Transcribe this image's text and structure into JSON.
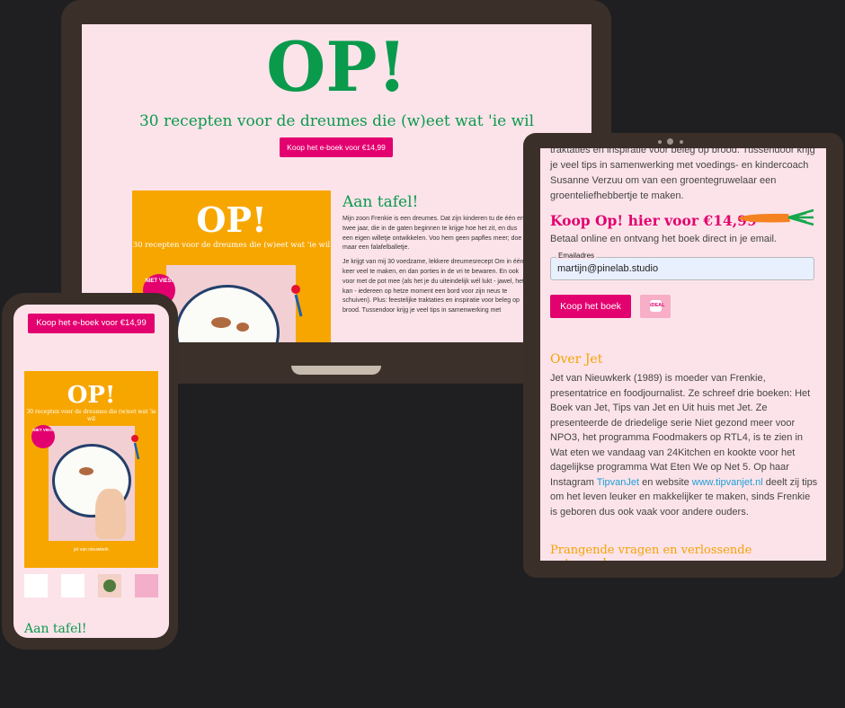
{
  "brand": {
    "green": "#0a9a4c",
    "pink": "#e3006f",
    "orange": "#f7a600",
    "background": "#fce3ea"
  },
  "laptop": {
    "logo": "OP!",
    "subtitle": "30 recepten voor de dreumes die (w)eet wat 'ie wil",
    "buy_button": "Koop het e-boek voor €14,99",
    "cover": {
      "logo": "OP!",
      "subtitle": "30 recepten voor de dreumes die (w)eet wat 'ie wil",
      "badge": "NIET VIES!"
    },
    "section_title": "Aan tafel!",
    "paragraphs": [
      "Mijn zoon Frenkie is een dreumes. Dat zijn kinderen tu de één en twee jaar, die in de gaten beginnen te krijge hoe het zit, en dus een eigen willetje ontwikkelen. Voo hem geen papfles meer; doe maar een falafelballetje.",
      "Je krijgt van mij 30 voedzame, lekkere dreumesrecept Om in één keer veel te maken, en dan porties in de vri te bewaren. En ook voor met de pot mee (als het je du uiteindelijk wél lukt - jawel, het kan - iedereen op hetze moment een bord voor zijn neus te schuiven). Plus: feestelijke traktaties en inspiratie voor beleg op brood. Tussendoor krijg je veel tips in samenwerking met"
    ]
  },
  "tablet": {
    "intro": "traktaties en inspiratie voor beleg op brood. Tussendoor krijg je veel tips in samenwerking met voedings- en kindercoach Susanne Verzuu om van een groentegruwelaar een groenteliefhebbertje te maken.",
    "buy_heading": "Koop Op! hier voor €14,99",
    "buy_sub": "Betaal online en ontvang het boek direct in je email.",
    "email_label": "Emailadres",
    "email_value": "martijn@pinelab.studio",
    "buy_button": "Koop het boek",
    "payment_icon": "iDEAL",
    "about_heading": "Over Jet",
    "about_text_1": "Jet van Nieuwkerk (1989) is moeder van Frenkie, presentatrice en foodjournalist. Ze schreef drie boeken: Het Boek van Jet, Tips van Jet en Uit huis met Jet. Ze presenteerde de driedelige serie Niet gezond meer voor NPO3, het programma Foodmakers op RTL4, is te zien in Wat eten we vandaag van 24Kitchen en kookte voor het dagelijkse programma Wat Eten We op Net 5. Op haar Instagram ",
    "about_link_1": "TipvanJet",
    "about_text_2": " en website ",
    "about_link_2": "www.tipvanjet.nl",
    "about_text_3": " deelt zij tips om het leven leuker en makkelijker te maken, sinds Frenkie is geboren dus ook vaak voor andere ouders.",
    "faq_heading": "Prangende vragen en verlossende antwoorden"
  },
  "phone": {
    "buy_button": "Koop het e-boek voor €14,99",
    "cover": {
      "logo": "OP!",
      "subtitle": "30 recepten voor de dreumes die (w)eet wat 'ie wil",
      "badge": "NIET VIES!",
      "author": "jet van nieuwkerk"
    },
    "section_title": "Aan tafel!"
  }
}
